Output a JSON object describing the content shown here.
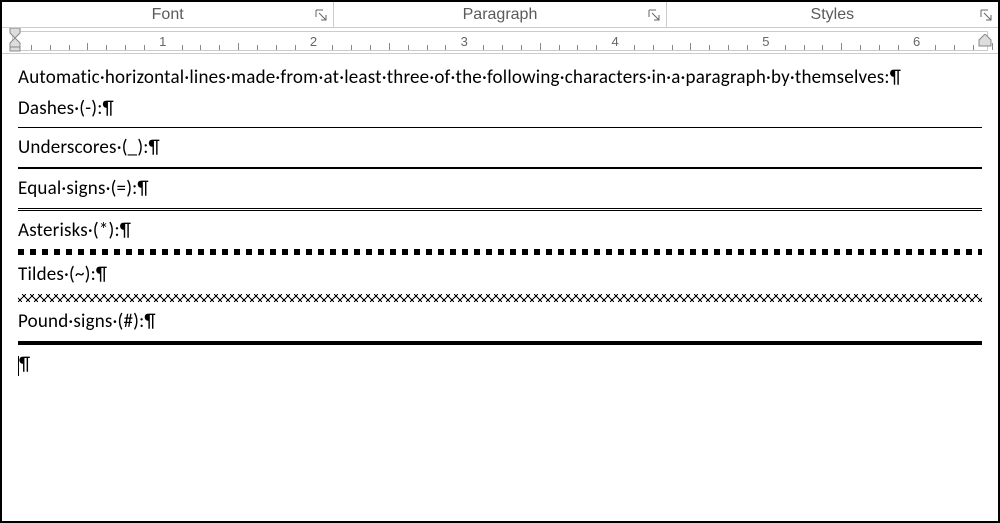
{
  "ribbon": {
    "groups": [
      {
        "label": "Font"
      },
      {
        "label": "Paragraph"
      },
      {
        "label": "Styles"
      }
    ]
  },
  "ruler": {
    "major_numbers": [
      1,
      2,
      3,
      4,
      5,
      6
    ]
  },
  "document": {
    "intro": "Automatic·horizontal·lines·made·from·at·least·three·of·the·following·characters·in·a·paragraph·by·themselves:¶",
    "lines": [
      {
        "label": "Dashes·(-):¶",
        "type": "dash"
      },
      {
        "label": "Underscores·(_):¶",
        "type": "underscore"
      },
      {
        "label": "Equal·signs·(=):¶",
        "type": "equal"
      },
      {
        "label": "Asterisks·(*):¶",
        "type": "asterisk"
      },
      {
        "label": "Tildes·(~):¶",
        "type": "tilde"
      },
      {
        "label": "Pound·signs·(#):¶",
        "type": "pound"
      }
    ],
    "trailing_pilcrow": "¶"
  }
}
